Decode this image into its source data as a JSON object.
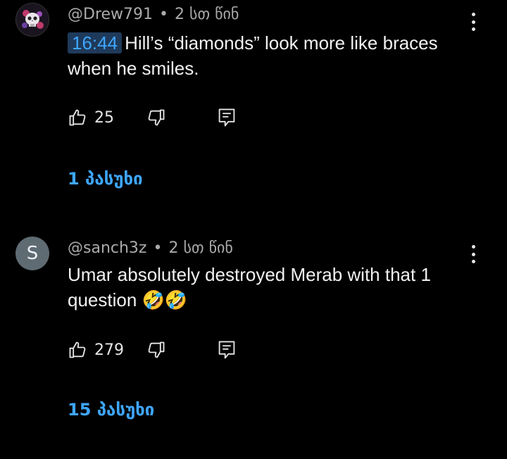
{
  "comments": [
    {
      "handle": "@Drew791",
      "separator": "•",
      "time_ago": "2 სთ წინ",
      "timestamp_link": "16:44",
      "text": "Hill’s “diamonds” look more like braces when he smiles.",
      "likes": "25",
      "replies_label": "1 პასუხი",
      "avatar_icon": "skull-avatar-icon"
    },
    {
      "handle": "@sanch3z",
      "separator": "•",
      "time_ago": "2 სთ წინ",
      "avatar_letter": "S",
      "text": "Umar absolutely destroyed Merab with that 1 question 🤣🤣",
      "likes": "279",
      "replies_label": "15 პასუხი"
    }
  ],
  "colors": {
    "background": "#000000",
    "link": "#3ea6ff",
    "secondary_text": "#aaaaaa",
    "primary_text": "#f1f1f1"
  }
}
